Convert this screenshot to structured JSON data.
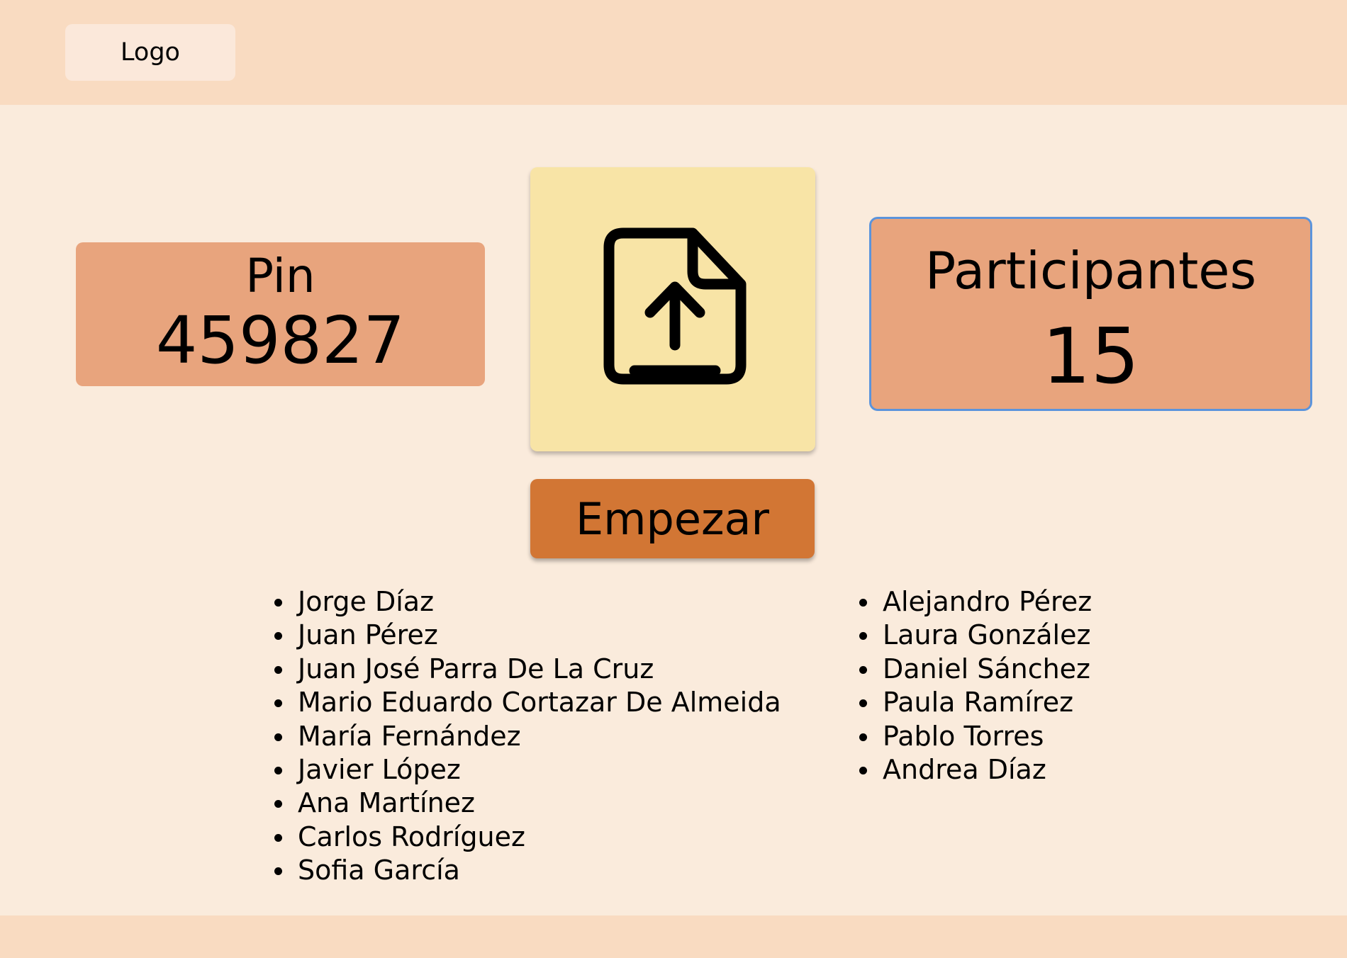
{
  "header": {
    "logo_text": "Logo"
  },
  "pin": {
    "title": "Pin",
    "value": "459827"
  },
  "upload": {
    "icon": "file-upload-icon"
  },
  "start_button": {
    "label": "Empezar"
  },
  "participants": {
    "title": "Participantes",
    "count": "15"
  },
  "participant_list": {
    "left": [
      "Jorge Díaz",
      "Juan Pérez",
      "Juan José Parra De La Cruz",
      "Mario Eduardo Cortazar De Almeida",
      "María Fernández",
      "Javier López",
      "Ana Martínez",
      "Carlos Rodríguez",
      "Sofia García"
    ],
    "right": [
      "Alejandro Pérez",
      "Laura González",
      "Daniel Sánchez",
      "Paula Ramírez",
      "Pablo Torres",
      "Andrea Díaz"
    ]
  },
  "colors": {
    "background": "#faebdc",
    "header": "#f9dbc1",
    "card": "#e8a47d",
    "upload_card": "#f8e4a6",
    "button": "#d27634",
    "focus_border": "#5b94dc"
  }
}
